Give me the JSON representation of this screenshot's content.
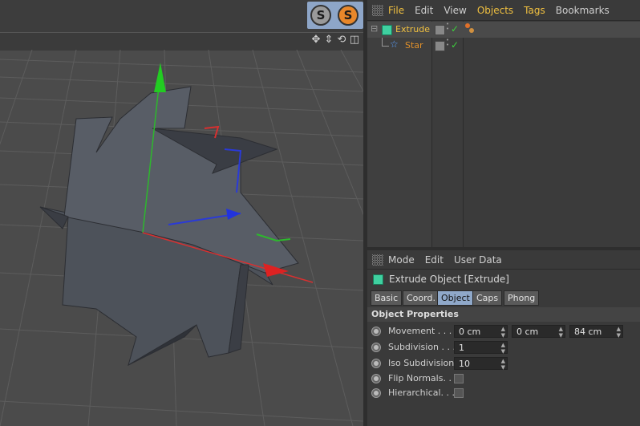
{
  "object_manager": {
    "menu": [
      "File",
      "Edit",
      "View",
      "Objects",
      "Tags",
      "Bookmarks"
    ],
    "objects": [
      {
        "name": "Extrude"
      },
      {
        "name": "Star"
      }
    ]
  },
  "attribute_manager": {
    "menu": [
      "Mode",
      "Edit",
      "User Data"
    ],
    "object_title": "Extrude Object [Extrude]",
    "tabs": [
      "Basic",
      "Coord.",
      "Object",
      "Caps",
      "Phong"
    ],
    "active_tab": "Object",
    "section_title": "Object Properties",
    "props": {
      "movement_label": "Movement . . .",
      "movement_x": "0 cm",
      "movement_y": "0 cm",
      "movement_z": "84 cm",
      "subdivision_label": "Subdivision . . .",
      "subdivision_value": "1",
      "iso_label": "Iso Subdivision",
      "iso_value": "10",
      "flip_label": "Flip Normals. .",
      "hier_label": "Hierarchical. . ."
    }
  },
  "viewport": {
    "solo_buttons": [
      "S",
      "S"
    ]
  },
  "colors": {
    "accent_blue": "#8ea6c8",
    "solo_orange": "#e8872a",
    "active_text": "#f0c040"
  }
}
